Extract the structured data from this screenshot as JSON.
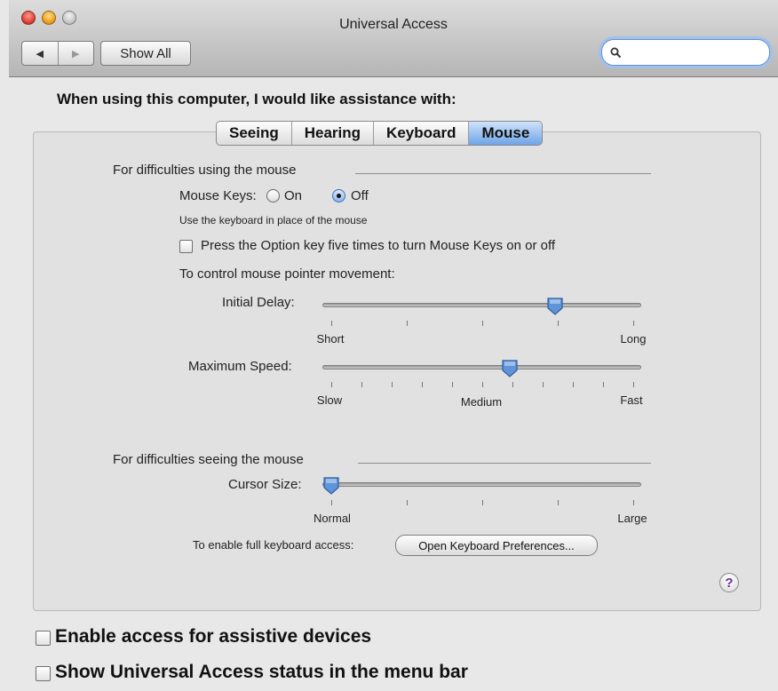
{
  "window": {
    "title": "Universal Access"
  },
  "toolbar": {
    "back_label": "◀",
    "forward_label": "▶",
    "show_all_label": "Show All",
    "search_value": ""
  },
  "heading": "When using this computer, I would like assistance with:",
  "tabs": [
    {
      "label": "Seeing",
      "active": false
    },
    {
      "label": "Hearing",
      "active": false
    },
    {
      "label": "Keyboard",
      "active": false
    },
    {
      "label": "Mouse",
      "active": true
    }
  ],
  "mouse": {
    "section_difficulty_using": "For difficulties using the mouse",
    "mouse_keys_label": "Mouse Keys:",
    "mouse_keys_on": "On",
    "mouse_keys_off": "Off",
    "mouse_keys_selected": "Off",
    "mouse_keys_hint": "Use the keyboard in place of the mouse",
    "option_key_label": "Press the Option key five times to turn Mouse Keys on or off",
    "option_key_checked": false,
    "pointer_movement_label": "To control mouse pointer movement:",
    "initial_delay": {
      "label": "Initial Delay:",
      "value_fraction": 0.74,
      "min_label": "Short",
      "max_label": "Long",
      "tick_count": 5
    },
    "maximum_speed": {
      "label": "Maximum Speed:",
      "value_fraction": 0.59,
      "min_label": "Slow",
      "mid_label": "Medium",
      "max_label": "Fast",
      "tick_count": 11
    },
    "section_difficulty_seeing": "For difficulties seeing the mouse",
    "cursor_size": {
      "label": "Cursor Size:",
      "value_fraction": 0.0,
      "min_label": "Normal",
      "max_label": "Large",
      "tick_count": 5
    },
    "keyboard_access_label": "To enable full keyboard access:",
    "open_keyboard_prefs_label": "Open Keyboard Preferences...",
    "help_label": "?"
  },
  "bottom": {
    "assistive_devices_label": "Enable access for assistive devices",
    "assistive_devices_checked": false,
    "status_menu_label": "Show Universal Access status in the menu bar",
    "status_menu_checked": false
  },
  "colors": {
    "accent": "#6ea4e6",
    "help_icon": "#6a2aa0"
  }
}
